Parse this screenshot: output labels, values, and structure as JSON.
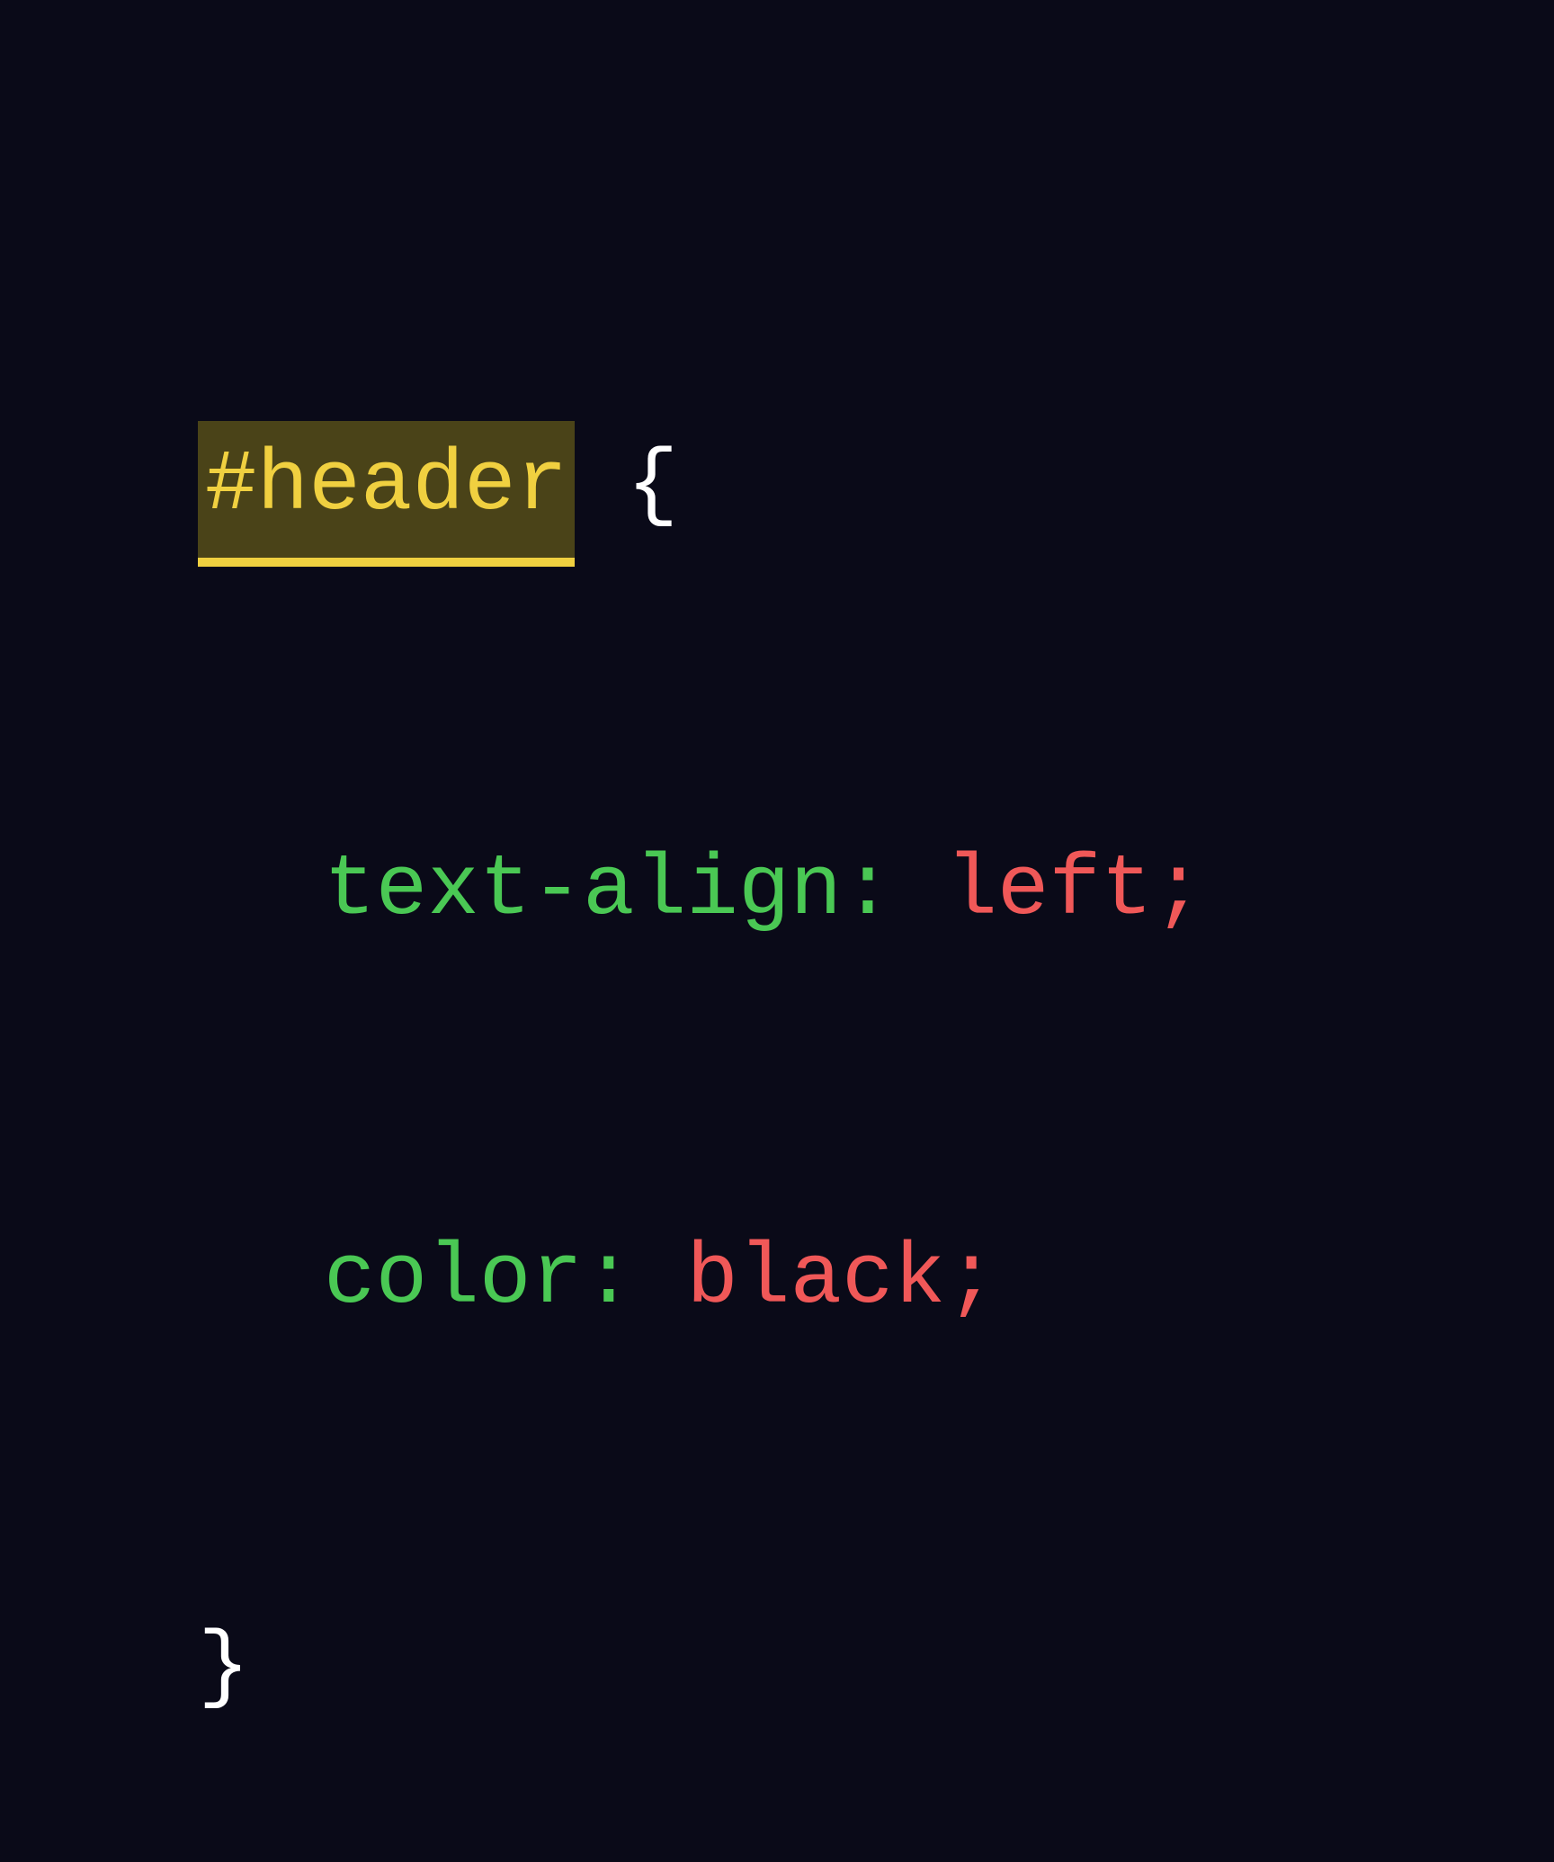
{
  "code": {
    "selector": "#header",
    "open_brace": " {",
    "close_brace": "}",
    "declarations": [
      {
        "property": "text-align",
        "colon_space": ": ",
        "value": "left",
        "semicolon": ";"
      },
      {
        "property": "color",
        "colon_space": ": ",
        "value": "black",
        "semicolon": ";"
      }
    ]
  },
  "colors": {
    "background": "#0a0a18",
    "selector_fg": "#f0d040",
    "selector_bg": "#4a4318",
    "selector_underline": "#f0d040",
    "property": "#4ac854",
    "value": "#f05858",
    "punctuation": "#ffffff"
  }
}
